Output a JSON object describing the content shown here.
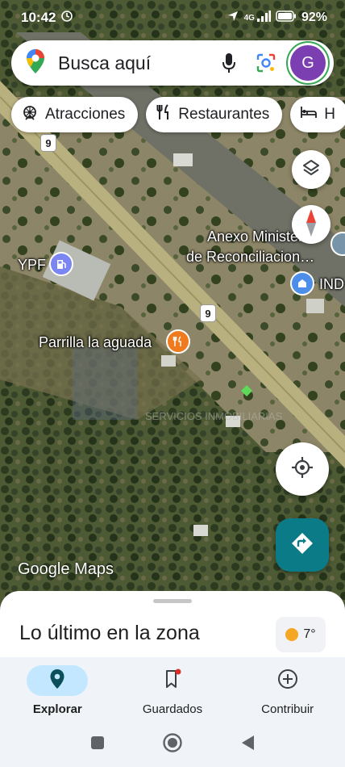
{
  "status": {
    "time": "10:42",
    "network": "4G",
    "battery": "92"
  },
  "search": {
    "placeholder": "Busca aquí",
    "avatar_letter": "G"
  },
  "chips": [
    {
      "label": "Atracciones",
      "icon": "attractions-icon"
    },
    {
      "label": "Restaurantes",
      "icon": "restaurant-icon"
    },
    {
      "label": "H",
      "icon": "hotel-icon"
    }
  ],
  "map": {
    "labels": {
      "ypf": "YPF",
      "anexo_line1": "Anexo Ministerio",
      "anexo_line2": "de Reconciliacion…",
      "ind": "IND",
      "parrilla": "Parrilla la aguada"
    },
    "route_number": "9",
    "attribution_google": "Google",
    "attribution_maps": "Maps"
  },
  "sheet": {
    "title": "Lo último en la zona",
    "temperature": "7°"
  },
  "nav": [
    {
      "label": "Explorar",
      "icon": "location-pin-icon",
      "active": true
    },
    {
      "label": "Guardados",
      "icon": "bookmark-icon",
      "active": false
    },
    {
      "label": "Contribuir",
      "icon": "add-circle-icon",
      "active": false
    }
  ],
  "colors": {
    "accent": "#0b7c87",
    "active_pill": "#c2e7ff",
    "avatar": "#7b3fb2"
  }
}
